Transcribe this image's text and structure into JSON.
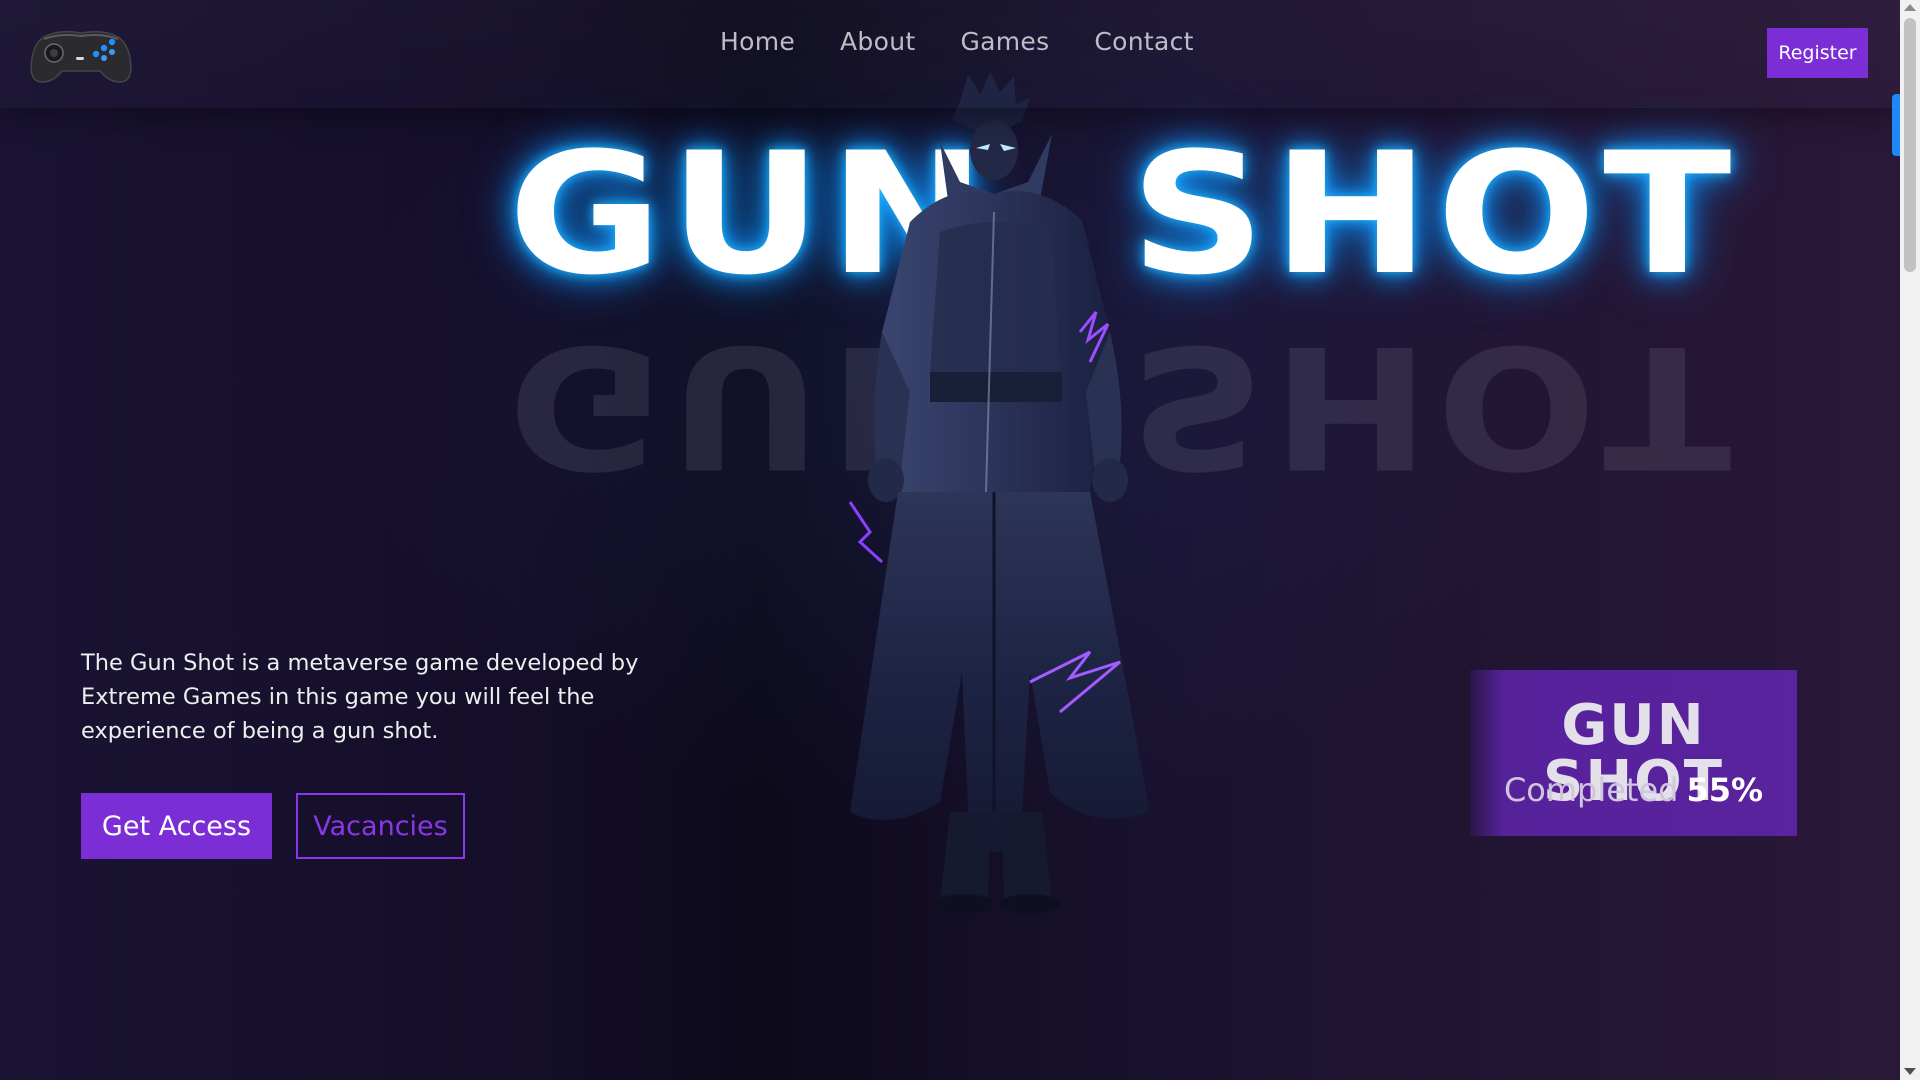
{
  "header": {
    "logo_icon": "gamepad-icon",
    "nav": [
      {
        "label": "Home"
      },
      {
        "label": "About"
      },
      {
        "label": "Games"
      },
      {
        "label": "Contact"
      }
    ],
    "register_label": "Register"
  },
  "hero": {
    "title_word_1": "GUN",
    "title_word_2": "SHOT",
    "description": "The Gun Shot is a metaverse game developed by Extreme Games in this game you will feel the experience of being a gun shot.",
    "primary_button": "Get Access",
    "secondary_button": "Vacancies"
  },
  "progress_card": {
    "title": "GUN SHOT",
    "label": "Completed",
    "value": "55%",
    "completion_fraction": 0.55
  },
  "colors": {
    "accent": "#7c2ed6",
    "glow": "#1fb4ff",
    "background": "#150f26"
  }
}
